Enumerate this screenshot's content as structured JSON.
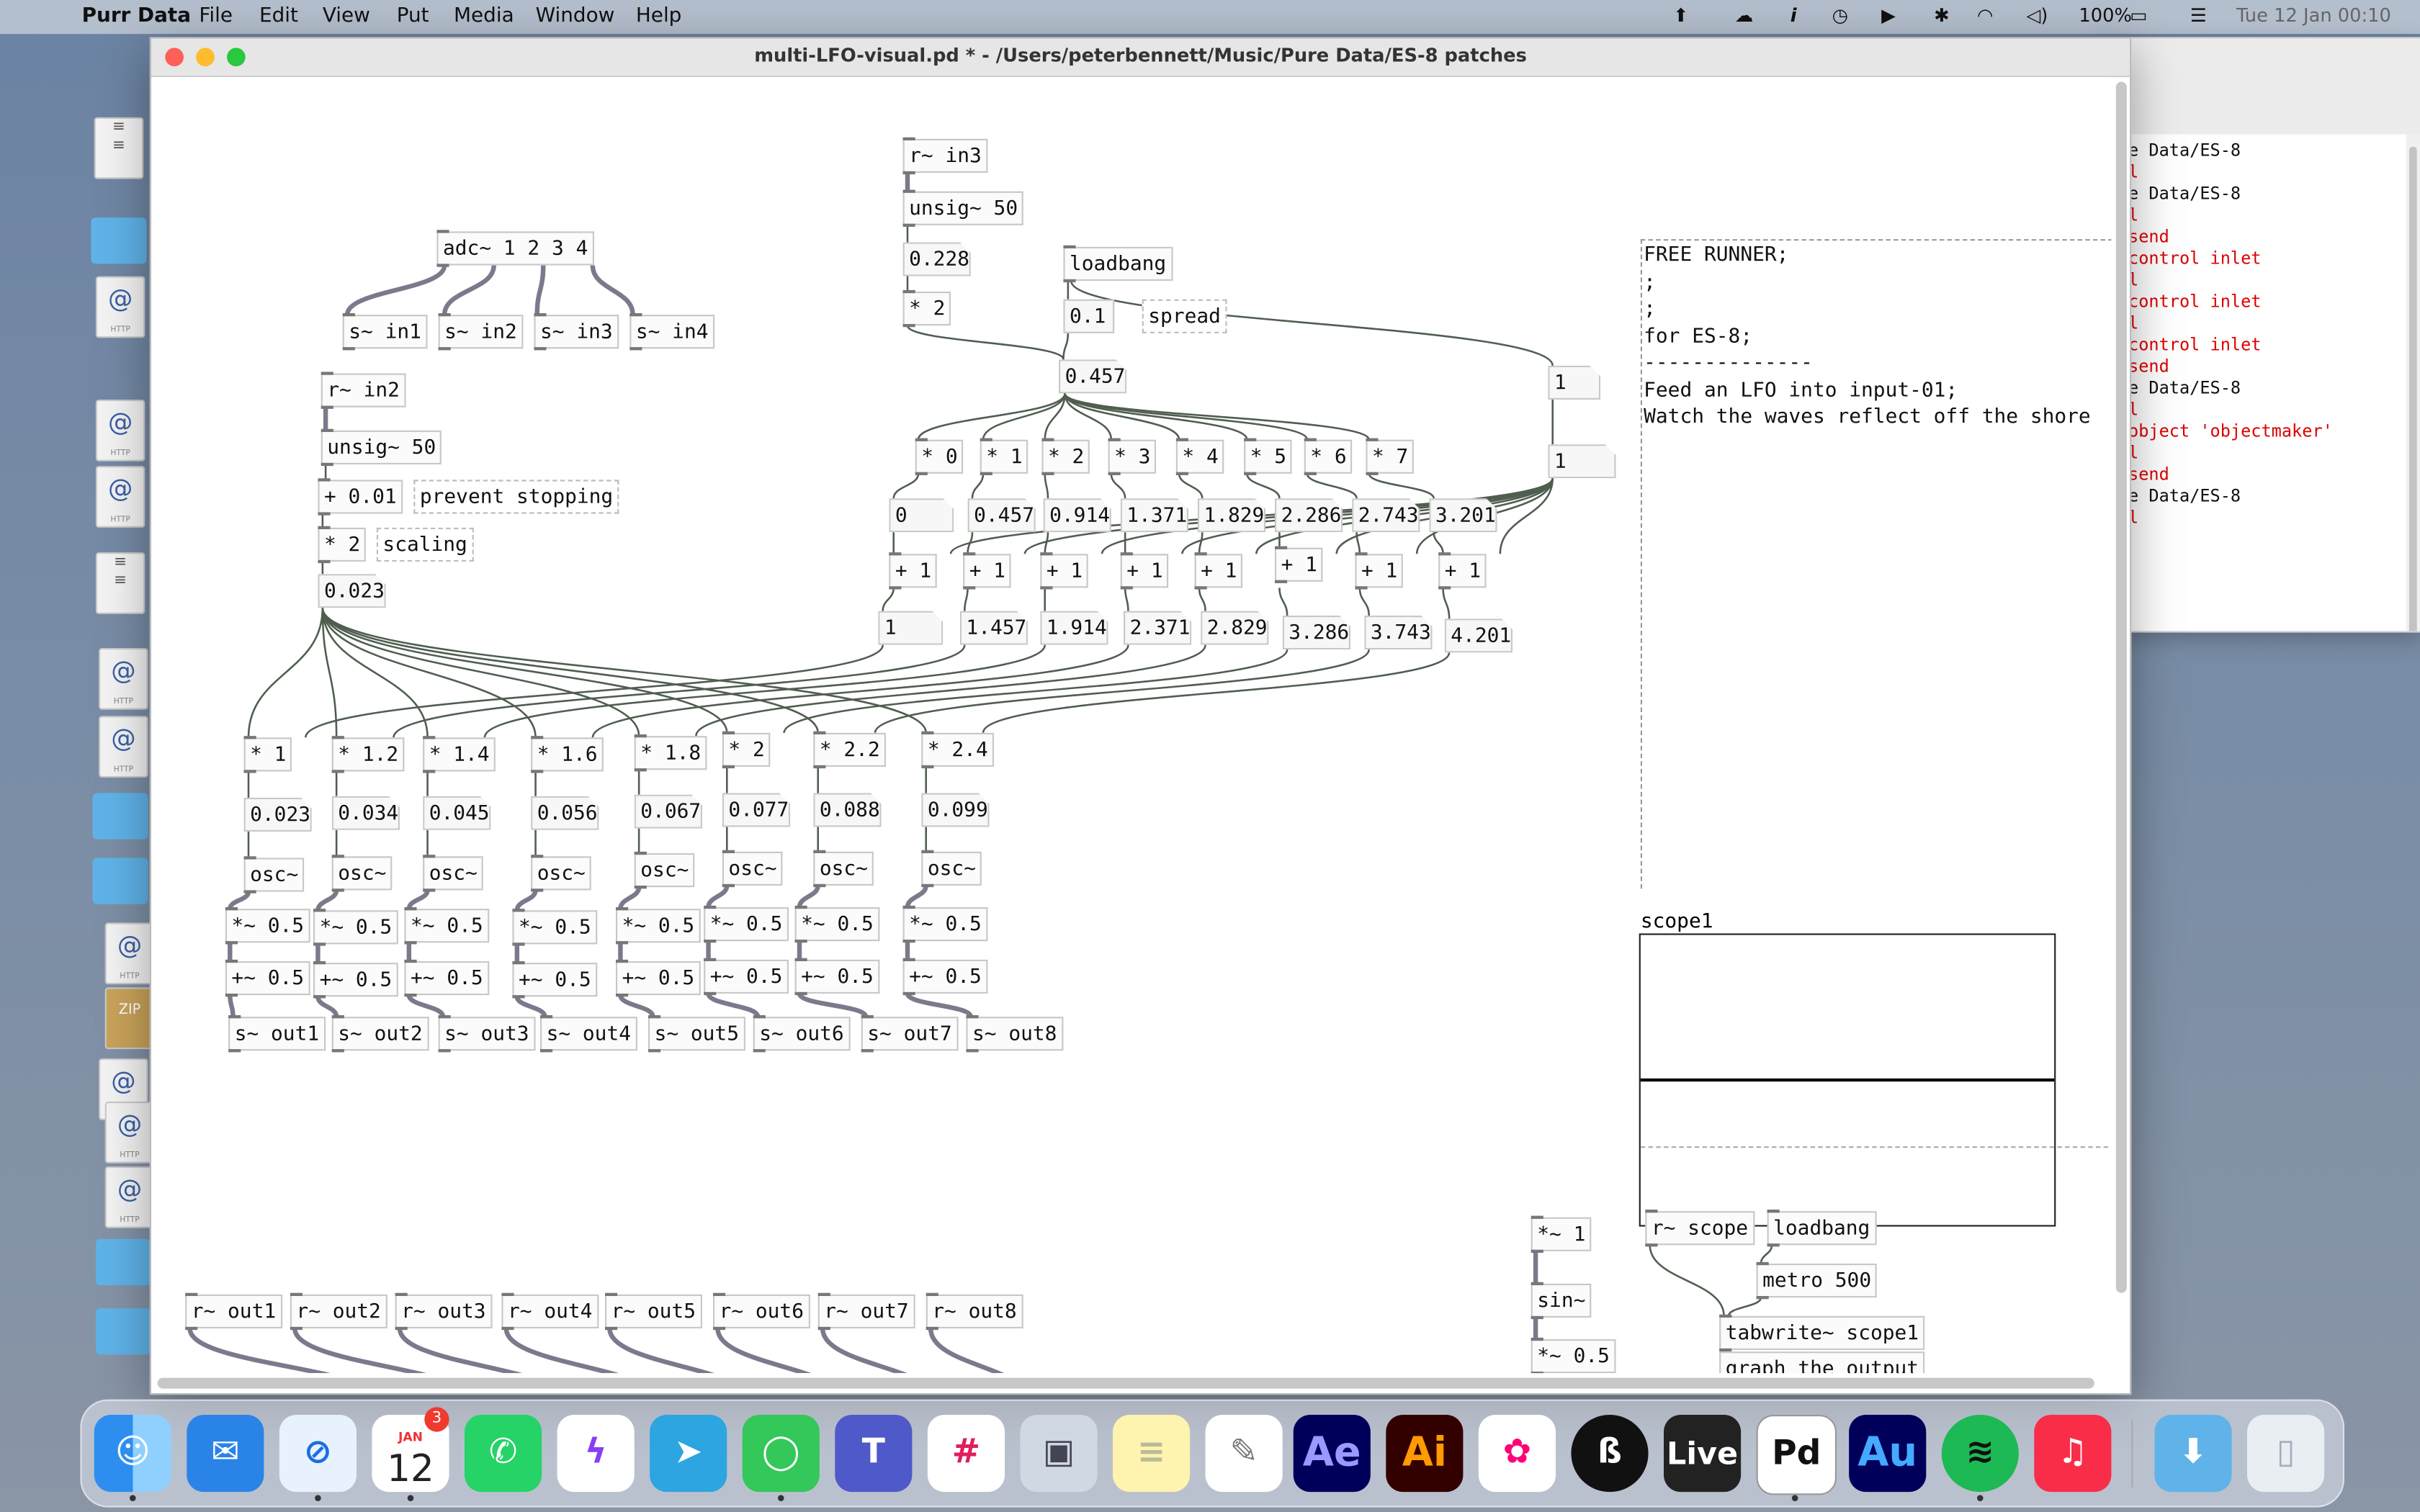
{
  "menubar": {
    "app": "Purr Data",
    "items": [
      "File",
      "Edit",
      "View",
      "Put",
      "Media",
      "Window",
      "Help"
    ],
    "battery": "100%",
    "clock": "Tue 12 Jan  00:10"
  },
  "window": {
    "title": "multi-LFO-visual.pd * - /Users/peterbennett/Music/Pure Data/ES-8 patches"
  },
  "console": {
    "lines": [
      {
        "text": "e Data/ES-8",
        "color": "#111"
      },
      {
        "text": "l",
        "color": "#d00"
      },
      {
        "text": "e Data/ES-8",
        "color": "#111"
      },
      {
        "text": "l",
        "color": "#d00"
      },
      {
        "text": " send",
        "color": "#d00"
      },
      {
        "text": " control inlet",
        "color": "#d00"
      },
      {
        "text": "l",
        "color": "#d00"
      },
      {
        "text": " control inlet",
        "color": "#d00"
      },
      {
        "text": "l",
        "color": "#d00"
      },
      {
        "text": " control inlet",
        "color": "#d00"
      },
      {
        "text": " send",
        "color": "#d00"
      },
      {
        "text": "e Data/ES-8",
        "color": "#111"
      },
      {
        "text": "l",
        "color": "#d00"
      },
      {
        "text": " object 'objectmaker'",
        "color": "#d00"
      },
      {
        "text": "l",
        "color": "#d00"
      },
      {
        "text": " send",
        "color": "#d00"
      },
      {
        "text": "e Data/ES-8",
        "color": "#111"
      },
      {
        "text": "l",
        "color": "#d00"
      }
    ]
  },
  "patch": {
    "adc": "adc~ 1 2 3 4",
    "sends_in": [
      "s~ in1",
      "s~ in2",
      "s~ in3",
      "s~ in4"
    ],
    "r_in2": "r~ in2",
    "unsig2": "unsig~ 50",
    "plus001": "+ 0.01",
    "prevent": "prevent stopping",
    "times2a": "* 2",
    "scaling": "scaling",
    "val0023": "0.023",
    "r_in3": "r~ in3",
    "unsig3": "unsig~ 50",
    "val0228": "0.228",
    "times2b": "* 2",
    "loadbang1": "loadbang",
    "msg01": "0.1",
    "spread": "spread",
    "val0457": "0.457",
    "mul_top": [
      "* 0",
      "* 1",
      "* 2",
      "* 3",
      "* 4",
      "* 5",
      "* 6",
      "* 7"
    ],
    "num_mid": [
      "0",
      "0.457",
      "0.914",
      "1.371",
      "1.829",
      "2.286",
      "2.743",
      "3.201"
    ],
    "plus1": [
      "+ 1",
      "+ 1",
      "+ 1",
      "+ 1",
      "+ 1",
      "+ 1",
      "+ 1",
      "+ 1"
    ],
    "num_low": [
      "1",
      "1.457",
      "1.914",
      "2.371",
      "2.829",
      "3.286",
      "3.743",
      "4.201"
    ],
    "right1": "1",
    "right2": "1",
    "mul_freq": [
      "* 1",
      "* 1.2",
      "* 1.4",
      "* 1.6",
      "* 1.8",
      "* 2",
      "* 2.2",
      "* 2.4"
    ],
    "freq_vals": [
      "0.023",
      "0.034",
      "0.045",
      "0.056",
      "0.067",
      "0.077",
      "0.088",
      "0.099"
    ],
    "osc": [
      "osc~",
      "osc~",
      "osc~",
      "osc~",
      "osc~",
      "osc~",
      "osc~",
      "osc~"
    ],
    "mul05": [
      "*~ 0.5",
      "*~ 0.5",
      "*~ 0.5",
      "*~ 0.5",
      "*~ 0.5",
      "*~ 0.5",
      "*~ 0.5",
      "*~ 0.5"
    ],
    "add05": [
      "+~ 0.5",
      "+~ 0.5",
      "+~ 0.5",
      "+~ 0.5",
      "+~ 0.5",
      "+~ 0.5",
      "+~ 0.5",
      "+~ 0.5"
    ],
    "outs": [
      "s~ out1",
      "s~ out2",
      "s~ out3",
      "s~ out4",
      "s~ out5",
      "s~ out6",
      "s~ out7",
      "s~ out8"
    ],
    "routs": [
      "r~ out1",
      "r~ out2",
      "r~ out3",
      "r~ out4",
      "r~ out5",
      "r~ out6",
      "r~ out7",
      "r~ out8"
    ],
    "notes": [
      "FREE RUNNER;",
      ";",
      ";",
      "for ES-8;",
      "--------------",
      "Feed an LFO into input-01;",
      "Watch the waves reflect off the shore"
    ],
    "scope_label": "scope1",
    "mul1": "*~ 1",
    "sin": "sin~",
    "mul05b": "*~ 0.5",
    "rscope": "r~ scope",
    "loadbang2": "loadbang",
    "metro": "metro 500",
    "tabwrite": "tabwrite~ scope1",
    "graph": "graph the output"
  },
  "dock": {
    "calendar_month": "JAN",
    "calendar_day": "12",
    "badge": "3",
    "apps": [
      "Finder",
      "Mail",
      "Safari",
      "Calendar",
      "WhatsApp",
      "Messenger",
      "Telegram",
      "Messages",
      "Teams",
      "Slack",
      "Preview",
      "Notes",
      "TextEdit",
      "After Effects",
      "Illustrator",
      "Photos",
      "Eagle",
      "Live",
      "Pd",
      "Audition",
      "Spotify",
      "Music",
      "Downloads",
      "Trash"
    ],
    "labels": {
      "ae": "Ae",
      "ai": "Ai",
      "live": "Live",
      "pd": "Pd",
      "au": "Au"
    }
  },
  "colors": {
    "wire": "#4f5e4f",
    "signal_wire": "#7a7a8c",
    "error_text": "#dd0000"
  }
}
